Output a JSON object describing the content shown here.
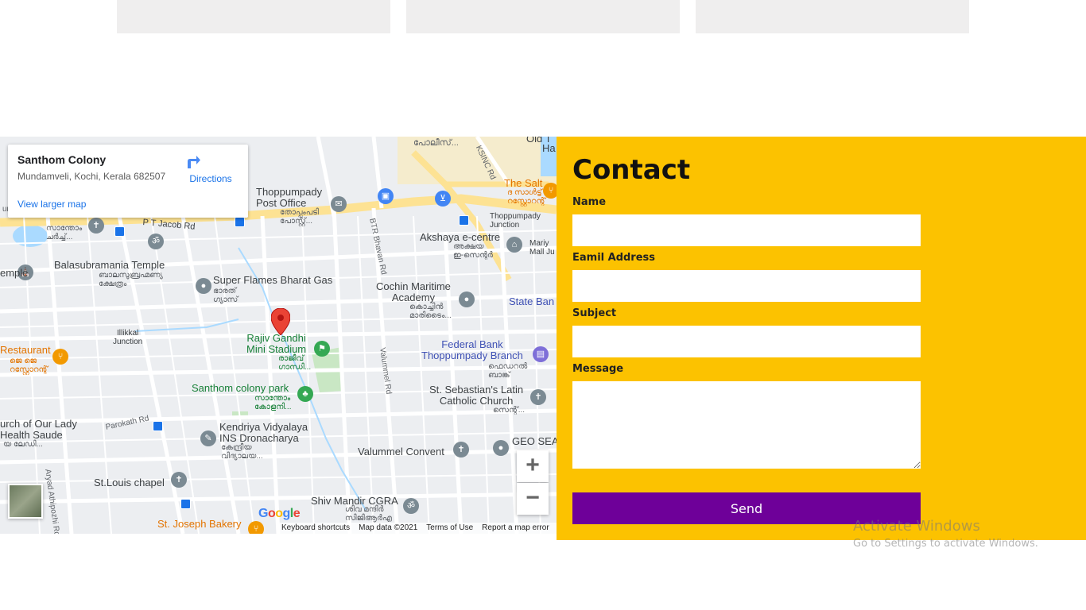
{
  "map": {
    "place_title": "Santhom Colony",
    "place_address": "Mundamveli, Kochi, Kerala 682507",
    "view_larger_map": "View larger map",
    "directions_label": "Directions",
    "zoom_in": "+",
    "zoom_out": "−",
    "google_logo": "Google",
    "footer": {
      "keyboard": "Keyboard shortcuts",
      "map_data": "Map data ©2021",
      "terms": "Terms of Use",
      "report": "Report a map error"
    },
    "labels": {
      "thoppumpady_po": "Thoppumpady\nPost Office",
      "thoppumpady_po_ml": "തോപ്പുംപടി\nപോസ്റ്റ്...",
      "police": "പോലീസ്...",
      "police_top": "കാറ്റ...",
      "ksinc": "KSINC Rd",
      "old": "Old T",
      "ha": "Ha",
      "the_salt": "The Salt",
      "the_salt_ml": "ദ സാൾട്ട്\nറസ്റ്റോറന്റ്",
      "junction": "Thoppumpady\nJunction",
      "akshaya": "Akshaya e-centre",
      "akshaya_ml": "അക്ഷയ\nഇ-സെന്റർ",
      "mari": "Mariy\nMall Ju",
      "btr": "BTR Bhavan Rd",
      "pt_jacob": "P T Jacob Rd",
      "santhom_top": "സാന്തോം\nചർച്ച്...",
      "church": "urch",
      "balasubramania": "Balasubramania Temple",
      "balasubramania_ml": "ബാലസുബ്രഹ്മണ്യ\nക്ഷേത്രം",
      "emple": "emple",
      "super_flames": "Super Flames Bharat Gas",
      "super_flames_ml": "ഭാരത്\nഗ്യാസ്",
      "cochin_maritime": "Cochin Maritime\nAcademy",
      "cochin_maritime_ml": "കൊച്ചിൻ\nമാരിടൈം...",
      "state_bank": "State Ban",
      "illikkal": "Illikkal\nJunction",
      "rajiv": "Rajiv Gandhi\nMini Stadium",
      "rajiv_ml": "രാജീവ്\nഗാന്ധി...",
      "restaurant": "Restaurant",
      "restaurant_ml": "ജെ ജെ\nറസ്റ്റോറന്റ്",
      "federal": "Federal Bank\nThoppumpady Branch",
      "federal_ml": "ഫെഡറൽ\nബാങ്ക്",
      "valummel_rd": "Valummel Rd",
      "santhom_park": "Santhom colony park",
      "santhom_park_ml": "സാന്തോം\nകോളനി...",
      "st_sebastian": "St. Sebastian's Latin\nCatholic Church",
      "st_sebastian_ml": "സെന്റ്...",
      "our_lady": "urch of Our Lady\nHealth Saude",
      "our_lady_ml": "യ ലേഡി...",
      "parokath": "Parokath Rd",
      "kendriya": "Kendriya Vidyalaya\nINS Dronacharya",
      "kendriya_ml": "കേന്ദ്രീയ\nവിദ്യാലയ...",
      "geo_sea": "GEO SEA",
      "valummel_convent": "Valummel Convent",
      "aryad": "Aryad Athipozhi Rd",
      "st_louis": "St.Louis chapel",
      "shiv_mandir": "Shiv Mandir CGRA",
      "shiv_mandir_ml": "ശിവ മന്ദിർ\nസിജിആർഎ",
      "st_joseph": "St. Joseph Bakery",
      "st_joseph_ml": "ബേക്കറി"
    }
  },
  "contact": {
    "title": "Contact",
    "name_label": "Name",
    "email_label": "Eamil Address",
    "subject_label": "Subject",
    "message_label": "Message",
    "name_value": "",
    "email_value": "",
    "subject_value": "",
    "message_value": "",
    "send_label": "Send"
  },
  "watermark": {
    "line1": "Activate Windows",
    "line2": "Go to Settings to activate Windows."
  },
  "colors": {
    "contact_bg": "#fcc200",
    "send_bg": "#6e0099",
    "placeholder_card": "#efeeee"
  }
}
